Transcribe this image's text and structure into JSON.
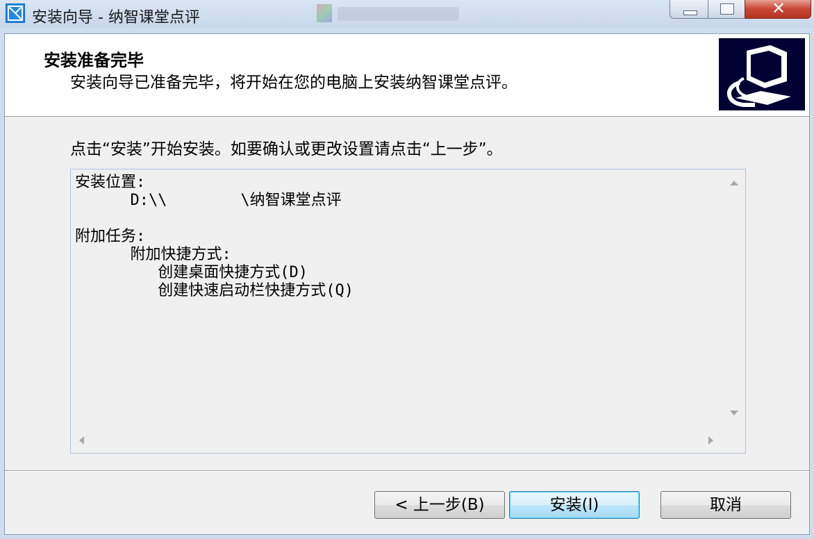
{
  "window": {
    "title": "安装向导 - 纳智课堂点评",
    "close_glyph": "✕"
  },
  "header": {
    "title": "安装准备完毕",
    "subtitle": "安装向导已准备完毕，将开始在您的电脑上安装纳智课堂点评。"
  },
  "instruction": "点击“安装”开始安装。如要确认或更改设置请点击“上一步”。",
  "memo": {
    "lines": [
      "安装位置:",
      "      D:\\\\        \\纳智课堂点评",
      "",
      "附加任务:",
      "      附加快捷方式:",
      "         创建桌面快捷方式(D)",
      "         创建快速启动栏快捷方式(Q)"
    ]
  },
  "buttons": {
    "back": "< 上一步(B)",
    "install": "安装(I)",
    "cancel": "取消"
  },
  "colors": {
    "wizard_image_bg": "#000033",
    "focus_button_border": "#3c7fb1"
  },
  "icons": {
    "app": "installer-app-icon",
    "wizard": "computer-install-icon"
  }
}
